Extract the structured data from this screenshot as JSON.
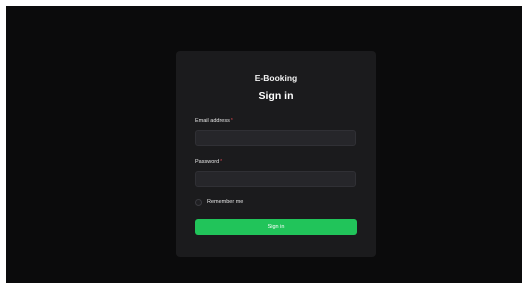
{
  "app": {
    "brand": "E-Booking"
  },
  "form": {
    "title": "Sign in",
    "email_label": "Email address",
    "email_value": "",
    "password_label": "Password",
    "password_value": "",
    "required_marker": "*",
    "remember_label": "Remember me",
    "remember_checked": false,
    "submit_label": "Sign in"
  },
  "colors": {
    "background": "#0b0b0c",
    "card": "#1b1b1d",
    "input": "#26262a",
    "accent": "#21c45a",
    "required": "#e0454f"
  }
}
